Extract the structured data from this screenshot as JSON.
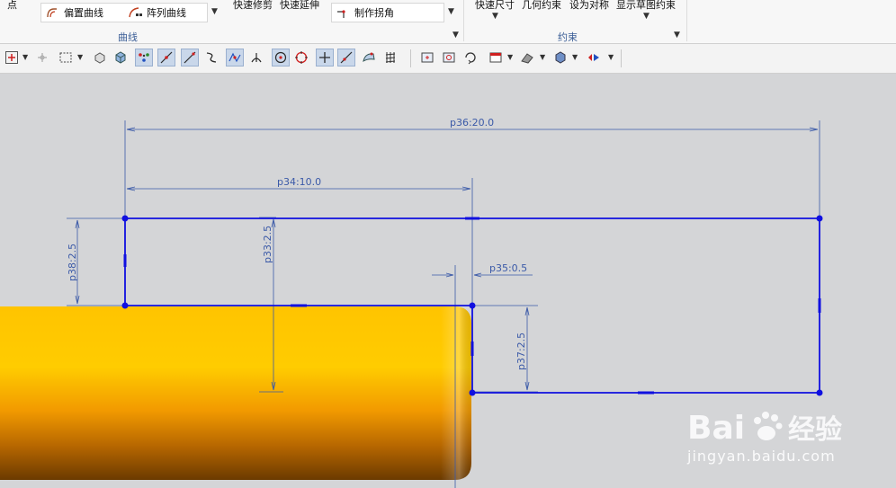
{
  "ribbon": {
    "point_label": "点",
    "offset_curve_label": "偏置曲线",
    "pattern_curve_label": "阵列曲线",
    "quick_trim_label": "快速修剪",
    "quick_extend_label": "快速延伸",
    "make_corner_label": "制作拐角",
    "curve_group_label": "曲线",
    "rapid_dimension_label": "快速尺寸",
    "geometric_constraints_label": "几何约束",
    "make_symmetric_label": "设为对称",
    "show_sketch_constraints_label": "显示草图约束",
    "constraints_group_label": "约束"
  },
  "dimensions": {
    "p36": "p36:20.0",
    "p34": "p34:10.0",
    "p38": "p38:2.5",
    "p33": "p33:2.5",
    "p35": "p35:0.5",
    "p37": "p37:2.5"
  },
  "watermark": {
    "brand_text": "Bai",
    "brand_text_2": "经验",
    "url": "jingyan.baidu.com"
  },
  "colors": {
    "sketch_line": "#1010e0",
    "dimension": "#3b5aa8",
    "cylinder_top": "#ffc400",
    "cylinder_bottom": "#6b3a00",
    "viewport_bg": "#d4d5d7"
  }
}
